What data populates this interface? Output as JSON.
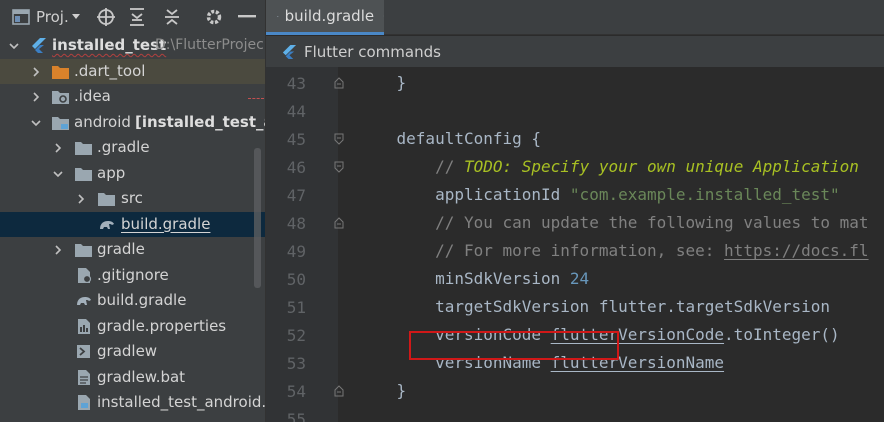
{
  "project_panel": {
    "toolbar_label": "Proj.",
    "tree": [
      {
        "label": "installed_test",
        "extra": "D:\\FlutterProjec",
        "bold": true
      },
      {
        "label": ".dart_tool"
      },
      {
        "label": ".idea"
      },
      {
        "label": "android",
        "extra": "[installed_test_and"
      },
      {
        "label": ".gradle"
      },
      {
        "label": "app"
      },
      {
        "label": "src"
      },
      {
        "label": "build.gradle"
      },
      {
        "label": "gradle"
      },
      {
        "label": ".gitignore"
      },
      {
        "label": "build.gradle"
      },
      {
        "label": "gradle.properties"
      },
      {
        "label": "gradlew"
      },
      {
        "label": "gradlew.bat"
      },
      {
        "label": "installed_test_android.im"
      }
    ]
  },
  "editor": {
    "tab_label": "build.gradle",
    "banner_label": "Flutter commands",
    "lines": [
      {
        "n": "43",
        "parts": [
          {
            "t": "    }",
            "c": ""
          }
        ]
      },
      {
        "n": "44",
        "parts": []
      },
      {
        "n": "45",
        "parts": [
          {
            "t": "    defaultConfig ",
            "c": ""
          },
          {
            "t": "{",
            "c": ""
          }
        ]
      },
      {
        "n": "46",
        "parts": [
          {
            "t": "        // ",
            "c": "cmt"
          },
          {
            "t": "TODO: Specify your own unique Application",
            "c": "todo"
          }
        ]
      },
      {
        "n": "47",
        "parts": [
          {
            "t": "        applicationId ",
            "c": ""
          },
          {
            "t": "\"com.example.installed_test\"",
            "c": "str"
          }
        ]
      },
      {
        "n": "48",
        "parts": [
          {
            "t": "        // You can update the following values to mat",
            "c": "cmt"
          }
        ]
      },
      {
        "n": "49",
        "parts": [
          {
            "t": "        // For more information, see: ",
            "c": "cmt"
          },
          {
            "t": "https://docs.fl",
            "c": "url"
          }
        ]
      },
      {
        "n": "50",
        "parts": [
          {
            "t": "        minSdkVersion ",
            "c": ""
          },
          {
            "t": "24",
            "c": "num"
          }
        ]
      },
      {
        "n": "51",
        "parts": [
          {
            "t": "        targetSdkVersion flutter.targetSdkVersion",
            "c": ""
          }
        ]
      },
      {
        "n": "52",
        "parts": [
          {
            "t": "        versionCode ",
            "c": ""
          },
          {
            "t": "flutterVersionCode",
            "c": "prop"
          },
          {
            "t": ".toInteger()",
            "c": ""
          }
        ]
      },
      {
        "n": "53",
        "parts": [
          {
            "t": "        versionName ",
            "c": ""
          },
          {
            "t": "flutterVersionName",
            "c": "prop"
          }
        ]
      },
      {
        "n": "54",
        "parts": [
          {
            "t": "    }",
            "c": ""
          }
        ]
      },
      {
        "n": "55",
        "parts": []
      }
    ]
  },
  "colors": {
    "accent": "#4a88c7",
    "highlight_box": "#d01818",
    "selection": "#0d293e"
  }
}
